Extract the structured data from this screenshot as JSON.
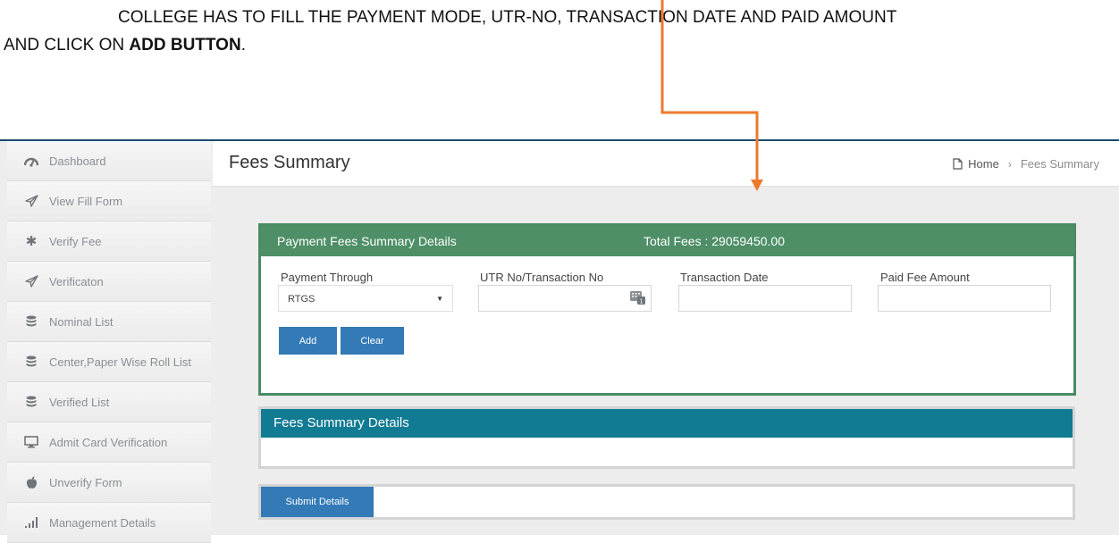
{
  "instruction": {
    "line1": "COLLEGE HAS TO FILL THE PAYMENT MODE, UTR-NO, TRANSACTION DATE AND PAID AMOUNT",
    "line2_plain": "AND CLICK ON ",
    "line2_bold": "ADD BUTTON",
    "line2_end": "."
  },
  "sidebar": {
    "items": [
      {
        "label": "Dashboard",
        "icon": "dashboard-icon"
      },
      {
        "label": "View Fill Form",
        "icon": "paper-plane-icon"
      },
      {
        "label": "Verify Fee",
        "icon": "asterisk-icon"
      },
      {
        "label": "Verificaton",
        "icon": "paper-plane-icon"
      },
      {
        "label": "Nominal List",
        "icon": "database-icon"
      },
      {
        "label": "Center,Paper Wise Roll List",
        "icon": "database-icon"
      },
      {
        "label": "Verified List",
        "icon": "database-icon"
      },
      {
        "label": "Admit Card Verification",
        "icon": "monitor-icon"
      },
      {
        "label": "Unverify Form",
        "icon": "apple-icon"
      },
      {
        "label": "Management Details",
        "icon": "signal-icon"
      }
    ]
  },
  "header": {
    "title": "Fees Summary",
    "breadcrumb": {
      "home": "Home",
      "current": "Fees Summary"
    }
  },
  "payment_panel": {
    "title": "Payment Fees Summary Details",
    "total": "Total Fees : 29059450.00",
    "fields": {
      "payment_through": {
        "label": "Payment Through",
        "value": "RTGS"
      },
      "utr": {
        "label": "UTR No/Transaction No",
        "value": ""
      },
      "transaction_date": {
        "label": "Transaction Date",
        "value": ""
      },
      "paid_amount": {
        "label": "Paid Fee Amount",
        "value": ""
      }
    },
    "buttons": {
      "add": "Add",
      "clear": "Clear"
    }
  },
  "summary_panel": {
    "title": "Fees Summary Details"
  },
  "submit": {
    "label": "Submit Details"
  },
  "colors": {
    "accent_arrow": "#ec7a2e",
    "panel_green": "#4e8f67",
    "panel_teal": "#117b93",
    "button_blue": "#337ab7",
    "top_border": "#1c4a6e"
  }
}
